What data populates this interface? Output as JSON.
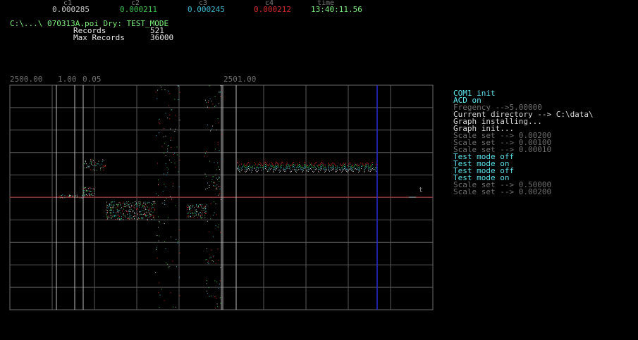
{
  "header": {
    "channels": [
      {
        "label": "c1",
        "value": "0.000285",
        "color": "#c8c8c8"
      },
      {
        "label": "c2",
        "value": "0.000211",
        "color": "#3cc24a"
      },
      {
        "label": "c3",
        "value": "0.000245",
        "color": "#3bb5c9"
      },
      {
        "label": "c4",
        "value": "0.000212",
        "color": "#d42a2a"
      },
      {
        "label": "time",
        "value": "13:40:11.56",
        "color": "#7cf07a"
      }
    ]
  },
  "file": {
    "path_line": "C:\\...\\ 070313A.poi Dry: TEST_MODE",
    "records_label": "Records",
    "records_value": "521",
    "max_records_label": "Max Records",
    "max_records_value": "36000"
  },
  "graph": {
    "labels": [
      "2500.00",
      "1.00",
      "0.05",
      "2501.00"
    ],
    "axis_t_label": "t"
  },
  "log": [
    {
      "text": "COM1 init",
      "color": "#5ee6f0"
    },
    {
      "text": "ACD on",
      "color": "#5ee6f0"
    },
    {
      "text": "Fregency -->5.00000",
      "color": "#6e6e6e"
    },
    {
      "text": "Current directory --> C:\\data\\",
      "color": "#d8d8d8"
    },
    {
      "text": "Graph installing...",
      "color": "#d8d8d8"
    },
    {
      "text": "Graph init...",
      "color": "#d8d8d8"
    },
    {
      "text": "Scale set --> 0.00200",
      "color": "#6e6e6e"
    },
    {
      "text": "Scale set --> 0.00100",
      "color": "#6e6e6e"
    },
    {
      "text": "Scale set --> 0.00010",
      "color": "#6e6e6e"
    },
    {
      "text": "Test mode off",
      "color": "#5ee6f0"
    },
    {
      "text": "Test mode on",
      "color": "#5ee6f0"
    },
    {
      "text": "Test mode off",
      "color": "#5ee6f0"
    },
    {
      "text": "Test mode on",
      "color": "#5ee6f0"
    },
    {
      "text": "Scale set --> 0.50000",
      "color": "#6e6e6e"
    },
    {
      "text": "Scale set --> 0.00200",
      "color": "#6e6e6e"
    }
  ]
}
